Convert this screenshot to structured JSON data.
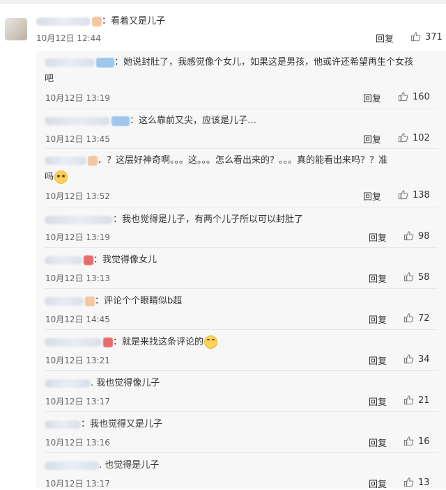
{
  "main": {
    "text": "：看着又是儿子",
    "time": "10月12日 12:44",
    "reply_label": "回复",
    "likes": "371"
  },
  "replies": [
    {
      "text": "：她说封肚了，我感觉像个女儿，如果这是男孩，他或许还希望再生个女孩",
      "text2": "吧",
      "time": "10月12日 13:19",
      "reply_label": "回复",
      "likes": "160"
    },
    {
      "text": "：这么靠前又尖，应该是儿子…",
      "time": "10月12日 13:45",
      "reply_label": "回复",
      "likes": "102"
    },
    {
      "text": "．？这层好神奇啊。。。这。。。怎么看出来的？。。。真的能看出来吗？？准",
      "text2": "吗",
      "time": "10月12日 13:52",
      "reply_label": "回复",
      "likes": "138"
    },
    {
      "text": "：我也觉得是儿子，有两个儿子所以可以封肚了",
      "time": "10月12日 13:19",
      "reply_label": "回复",
      "likes": "98"
    },
    {
      "text": "：我觉得像女儿",
      "time": "10月12日 13:13",
      "reply_label": "回复",
      "likes": "58"
    },
    {
      "text": "：评论个个眼睛似b超",
      "time": "10月12日 14:45",
      "reply_label": "回复",
      "likes": "72"
    },
    {
      "text": "：就是来找这条评论的",
      "time": "10月12日 13:21",
      "reply_label": "回复",
      "likes": "34"
    },
    {
      "text": ". 我也觉得像儿子",
      "time": "10月12日 13:17",
      "reply_label": "回复",
      "likes": "21"
    },
    {
      "text": "：我也觉得又是儿子",
      "time": "10月12日 13:16",
      "reply_label": "回复",
      "likes": "16"
    },
    {
      "text": ". 也觉得是儿子",
      "time": "10月12日 13:17",
      "reply_label": "回复",
      "likes": "13"
    }
  ]
}
